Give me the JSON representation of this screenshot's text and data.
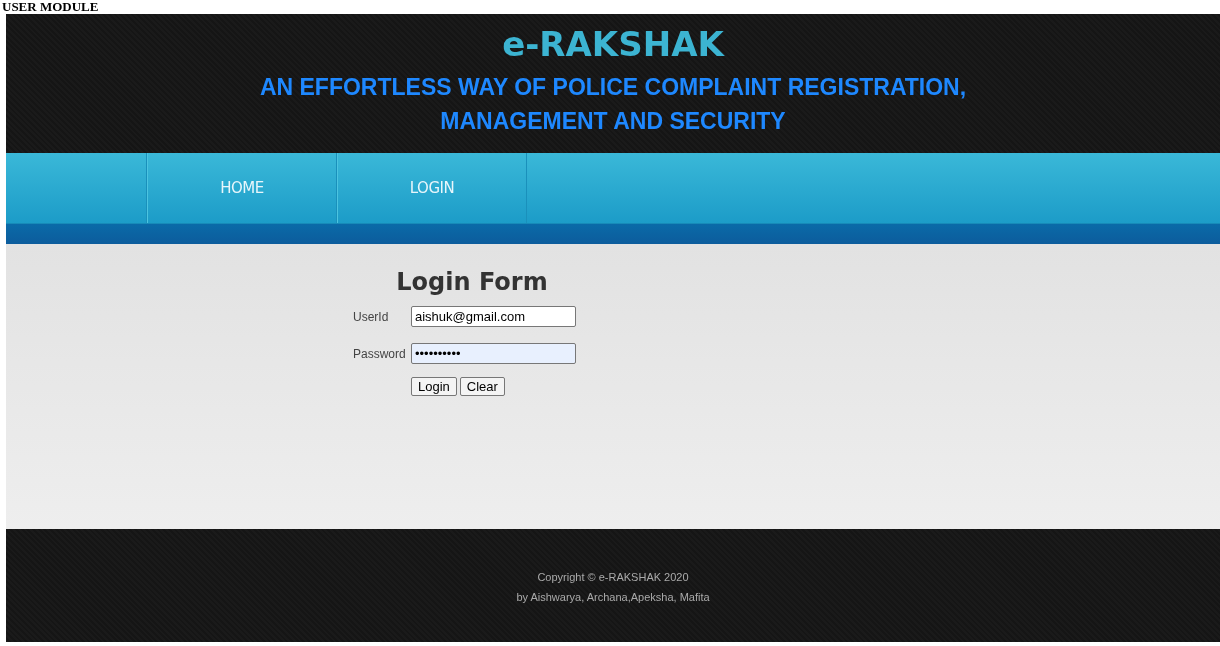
{
  "page_heading": "USER MODULE",
  "header": {
    "title": "e-RAKSHAK",
    "tagline_line1": "AN EFFORTLESS WAY OF POLICE COMPLAINT REGISTRATION,",
    "tagline_line2": "MANAGEMENT AND SECURITY"
  },
  "nav": [
    {
      "label": "HOME"
    },
    {
      "label": "LOGIN"
    }
  ],
  "form": {
    "title": "Login Form",
    "fields": [
      {
        "label": "UserId",
        "value": "aishuk@gmail.com",
        "autofilled": false
      },
      {
        "label": "Password",
        "value": "••••••••••",
        "autofilled": true
      }
    ],
    "buttons": [
      "Login",
      "Clear"
    ]
  },
  "footer": {
    "copyright": "Copyright © e-RAKSHAK 2020",
    "authors": "by Aishwarya, Archana,Apeksha, Mafita"
  }
}
